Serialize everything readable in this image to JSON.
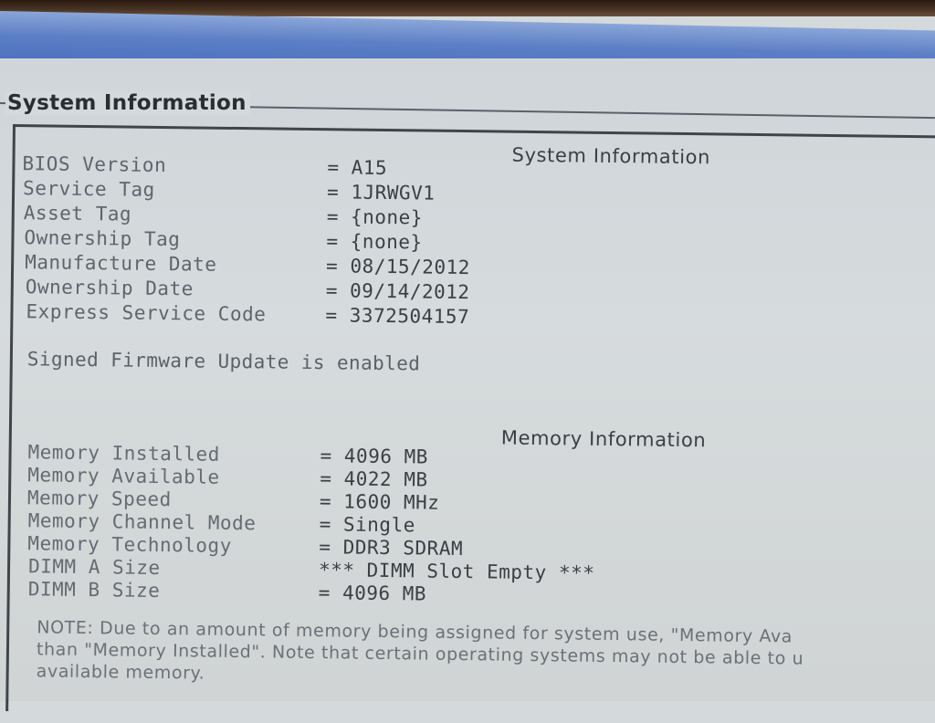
{
  "group_title": "System Information",
  "system": {
    "heading": "System Information",
    "rows": [
      {
        "label": "BIOS Version",
        "value": "= A15"
      },
      {
        "label": "Service Tag",
        "value": "= 1JRWGV1"
      },
      {
        "label": "Asset Tag",
        "value": "= {none}"
      },
      {
        "label": "Ownership Tag",
        "value": "= {none}"
      },
      {
        "label": "Manufacture Date",
        "value": "= 08/15/2012"
      },
      {
        "label": "Ownership Date",
        "value": "= 09/14/2012"
      },
      {
        "label": "Express Service Code",
        "value": "= 3372504157"
      }
    ],
    "firmware_message": "Signed Firmware Update is enabled"
  },
  "memory": {
    "heading": "Memory Information",
    "rows": [
      {
        "label": "Memory Installed",
        "value": "= 4096 MB"
      },
      {
        "label": "Memory Available",
        "value": "= 4022 MB"
      },
      {
        "label": "Memory Speed",
        "value": "= 1600 MHz"
      },
      {
        "label": "Memory Channel Mode",
        "value": "= Single"
      },
      {
        "label": "Memory Technology",
        "value": "= DDR3 SDRAM"
      },
      {
        "label": "DIMM A Size",
        "value": "*** DIMM Slot Empty ***"
      },
      {
        "label": "DIMM B Size",
        "value": "= 4096 MB"
      }
    ],
    "note_lines": [
      "NOTE: Due to an amount of memory being assigned for system use, \"Memory Ava",
      "than \"Memory Installed\". Note that certain operating systems may not be able to u",
      "available memory."
    ]
  }
}
